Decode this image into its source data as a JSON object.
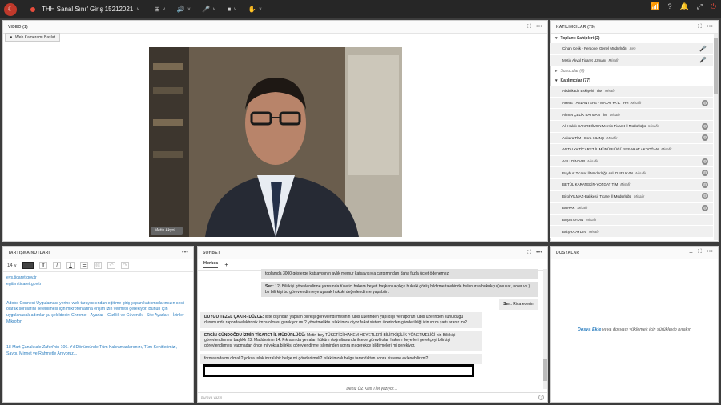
{
  "topbar": {
    "logo_glyph": "☾",
    "title": "THH Sanal Sınıf Giriş 15212021",
    "title_chevron": "∨",
    "apps_icon": "⊞",
    "speaker_icon": "🔊",
    "mic_icon": "🎤",
    "camera_icon": "■",
    "hand_icon": "✋",
    "chevron": "∨",
    "right_icons": [
      "📶",
      "?",
      "🔔",
      "⤢",
      "⏻"
    ]
  },
  "video": {
    "header": "VIDEO (1)",
    "start_cam": "Web Kameramı Başlat",
    "cam_icon": "■",
    "speaker_name": "Metin Akyol",
    "speaker_label": "Metin Akyol..."
  },
  "participants": {
    "header": "KATILIMCILAR  (79)",
    "hosts_group": "Toplantı Sahipleri (2)",
    "presenters_group": "Sunucular (0)",
    "attendees_group": "Katılımcılar (77)",
    "hosts": [
      {
        "name": "Cihan Çelik - Personel Genel Müdürlüğü",
        "role": "Sen",
        "icon": "🎤"
      },
      {
        "name": "Metin Akyol Ticaret Uzmanı",
        "role": "Misafir",
        "icon": "🎤"
      }
    ],
    "attendees": [
      {
        "name": "Abdulkadir Eskişehir TİM",
        "role": "Misafir",
        "badge": false
      },
      {
        "name": "AHMET ASLANTEPE - MALATYA İL THH",
        "role": "Misafir",
        "badge": true
      },
      {
        "name": "Ahmet ÇELİK BATMAN TİM",
        "role": "Misafir",
        "badge": false
      },
      {
        "name": "Ali Haluk BAKIRDÖVEN Mersin Ticaret İl Müdürlüğü",
        "role": "Misafir",
        "badge": true
      },
      {
        "name": "Ankara TİM - Esra KILINÇ",
        "role": "Misafir",
        "badge": true
      },
      {
        "name": "ANTALYA TİCARET İL MÜDÜRLÜĞÜ SEBAHAT AKDOĞAN",
        "role": "Misafir",
        "badge": false
      },
      {
        "name": "ASLI DİNDAR",
        "role": "Misafir",
        "badge": true
      },
      {
        "name": "Bayburt Ticaret İl Müdürlüğü Aslı DURUKAN",
        "role": "Misafir",
        "badge": true
      },
      {
        "name": "BETÜL KARATEKİN-YOZGAT TİM",
        "role": "Misafir",
        "badge": true
      },
      {
        "name": "Birol YILMAZ-Balıkesir Ticaret İl Müdürlüğü",
        "role": "Misafir",
        "badge": true
      },
      {
        "name": "BURAK",
        "role": "Misafir",
        "badge": true
      },
      {
        "name": "Büşra AYDIN",
        "role": "Misafir",
        "badge": false
      },
      {
        "name": "BÜŞRA AYDIN",
        "role": "Misafir",
        "badge": false
      }
    ]
  },
  "notes": {
    "header": "TARTIŞMA NOTLARI",
    "font_size": "14",
    "lines": [
      "eys.ticaret.gov.tr",
      "egitim.ticaret.gov.tr",
      "",
      "",
      "Adobe Connect Uygulaması yerine web tarayıcısından eğitime giriş yapan katılımcılarımızın sesli olarak sorularını iletebilmesi için mikrofonlarına erişim izin vermesi gerekiyor. Bunun için uygulanacak adımlar şu şekildedir: Chrome---Ayarlar---Gizlilik ve Güvenlik---Site Ayarları---İzinler---Mikrofon",
      "",
      "",
      "",
      "18 Mart Çanakkale Zaferi'nin 106. Yıl Dönümünde Tüm Kahramanlarımızı, Tüm Şehitlerimizi, Saygı, Minnet ve Rahmetle Anıyoruz..."
    ]
  },
  "chat": {
    "header": "SOHBET",
    "tab_everyone": "Herkes",
    "add_tab": "+",
    "messages": [
      {
        "sender": "",
        "text": "toplamda 3000 gösterge katsayısının aylık memur katsayısıyla çarpımından daha fazla ücret ödenemez.",
        "kind": "me"
      },
      {
        "sender": "Sen:",
        "text": " 12) Bilirkişi görevlendirme yazısında tüketici hakem heyeti başkanı açıkça hukuki görüş bildirme talebinde bulunursa hukukçu (avukat, noter vs.) bir bilirkişi bu görevlendirmeye uyarak hukuki değerlendirme yapabilir.",
        "kind": "me"
      },
      {
        "sender": "Sen:",
        "text": " Rica ederim",
        "kind": "sm"
      },
      {
        "sender": "DUYGU TEZEL ÇAKIR- DÜZCE:",
        "text": " liste dışından yapılan bilirkişi görevlendirmesinin tubis üzerinden yapıldığı ve raporun tubis üzerinden sunulduğu durumunda raporda elektronik imza olması gerekiyor mu? yönetmelikte ıslak imza diyor fakat sistem üzerinden gönderildiği için ımza şartı aranır mı?",
        "kind": "in"
      },
      {
        "sender": "ERGİN GÜNDOĞDU İZMİR TİCARET İL MÜDÜRLÜĞÜ:",
        "text": " Metin bey TÜKETİCİ HAKEM HEYETLERİ BİLİRKİŞİLİK YÖNETMELİĞİ nin Bilirkişi görevlendirmesi başlıklı 23. Maddesinin 14. Fıkrasında yer alan hüküm doğrultusunda ilçede görevli olan hakem heyetleri gerekçeyi bilirkişi görevlendirmesi yapmadan önce mi yoksa bilirkişi görevlendirme işleminden sonra mı gerekçe bildirmeleri mi gerekiyor.",
        "kind": "in"
      },
      {
        "sender": "",
        "text": "formatında mı olmalı? yoksa ıslak imzalı bir belge mi gönderilmeli? ıslak imzalı belge tarandıktan sonra sisteme eklenebilir mi?",
        "kind": "in"
      }
    ],
    "typing": "Deniz ÖZ Kilis TİM yazıyor...",
    "input_placeholder": "Buraya yazın",
    "help": "?"
  },
  "files": {
    "header": "DOSYALAR",
    "add": "+",
    "empty_link": "Dosya Ekle",
    "empty_text": " veya dosyayı yüklemek için sürükleyip bırakın"
  }
}
